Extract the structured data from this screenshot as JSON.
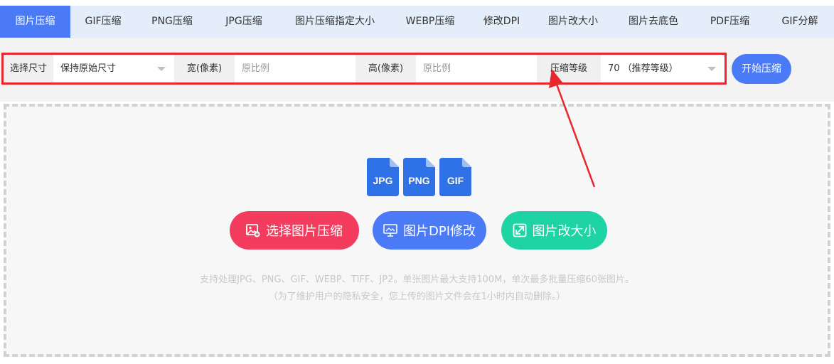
{
  "tabs": [
    {
      "label": "图片压缩",
      "active": true
    },
    {
      "label": "GIF压缩",
      "active": false
    },
    {
      "label": "PNG压缩",
      "active": false
    },
    {
      "label": "JPG压缩",
      "active": false
    },
    {
      "label": "图片压缩指定大小",
      "active": false
    },
    {
      "label": "WEBP压缩",
      "active": false
    },
    {
      "label": "修改DPI",
      "active": false
    },
    {
      "label": "图片改大小",
      "active": false
    },
    {
      "label": "图片去底色",
      "active": false
    },
    {
      "label": "PDF压缩",
      "active": false
    },
    {
      "label": "GIF分解",
      "active": false
    }
  ],
  "options": {
    "size_label": "选择尺寸",
    "size_value": "保持原始尺寸",
    "width_label": "宽(像素)",
    "width_placeholder": "原比例",
    "height_label": "高(像素)",
    "height_placeholder": "原比例",
    "level_label": "压缩等级",
    "level_value": "70 （推荐等级）"
  },
  "start_button": "开始压缩",
  "upload": {
    "file_types": [
      "JPG",
      "PNG",
      "GIF"
    ],
    "select_button": "选择图片压缩",
    "dpi_button": "图片DPI修改",
    "resize_button": "图片改大小",
    "support_text": "支持处理JPG、PNG、GIF、WEBP、TIFF、JP2。单张图片最大支持100M，单次最多批量压缩60张图片。",
    "privacy_text": "（为了维护用户的隐私安全，您上传的图片文件会在1小时内自动删除。）"
  },
  "colors": {
    "accent": "#4a7af5",
    "highlight_border": "#e8262d",
    "select_button": "#f43c5e",
    "resize_button": "#1ed3a4"
  },
  "icons": {
    "select_button": "image-add-icon",
    "dpi_button": "monitor-icon",
    "resize_button": "resize-icon"
  }
}
